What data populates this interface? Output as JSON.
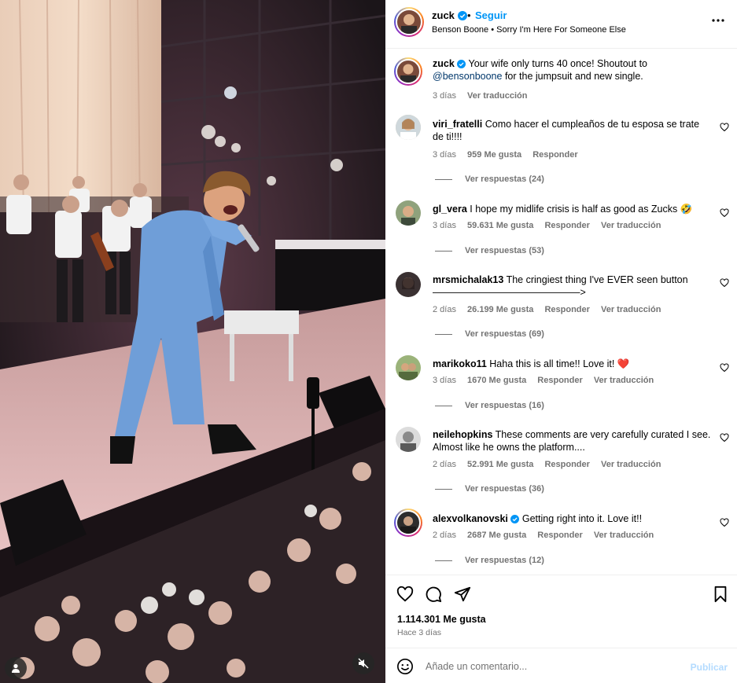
{
  "post": {
    "username": "zuck",
    "follow_label": "Seguir",
    "dot": "•",
    "audio": "Benson Boone • Sorry I'm Here For Someone Else",
    "caption_prefix": "Your wife only turns 40 once! Shoutout to",
    "caption_mention": "@bensonboone",
    "caption_suffix": "for the jumpsuit and new single.",
    "caption_time": "3 días",
    "caption_translate": "Ver traducción",
    "likes": "1.114.301 Me gusta",
    "posted_ago": "Hace 3 días"
  },
  "comments": [
    {
      "username": "viri_fratelli",
      "text": "Como hacer el cumpleaños de tu esposa se trate de ti!!!!",
      "time": "3 días",
      "likes": "959 Me gusta",
      "reply": "Responder",
      "translate": "",
      "replies": "Ver respuestas (24)"
    },
    {
      "username": "gl_vera",
      "text": "I hope my midlife crisis is half as good as Zucks 🤣",
      "time": "3 días",
      "likes": "59.631 Me gusta",
      "reply": "Responder",
      "translate": "Ver traducción",
      "replies": "Ver respuestas (53)"
    },
    {
      "username": "mrsmichalak13",
      "text": "The cringiest thing I've EVER seen button ———————————————>",
      "time": "2 días",
      "likes": "26.199 Me gusta",
      "reply": "Responder",
      "translate": "Ver traducción",
      "replies": "Ver respuestas (69)"
    },
    {
      "username": "marikoko11",
      "text": "Haha this is all time!! Love it! ❤️",
      "time": "3 días",
      "likes": "1670 Me gusta",
      "reply": "Responder",
      "translate": "Ver traducción",
      "replies": "Ver respuestas (16)"
    },
    {
      "username": "neilehopkins",
      "text": "These comments are very carefully curated I see. Almost like he owns the platform....",
      "time": "2 días",
      "likes": "52.991 Me gusta",
      "reply": "Responder",
      "translate": "Ver traducción",
      "replies": "Ver respuestas (36)"
    },
    {
      "username": "alexvolkanovski",
      "text": "Getting right into it. Love it!!",
      "time": "2 días",
      "likes": "2687 Me gusta",
      "reply": "Responder",
      "translate": "Ver traducción",
      "replies": "Ver respuestas (12)"
    }
  ],
  "comment_box": {
    "placeholder": "Añade un comentario...",
    "publish_label": "Publicar"
  },
  "icons": {
    "like": "heart-icon",
    "comment": "comment-icon",
    "share": "paper-plane-icon",
    "save": "bookmark-icon",
    "more": "more-options-icon",
    "emoji": "emoji-icon",
    "user_tag": "user-tag-icon",
    "mute": "muted-speaker-icon"
  },
  "colors": {
    "follow": "#0095f6",
    "secondary_text": "#737373",
    "publish_disabled": "#b3dbff",
    "verified": "#0095f6"
  }
}
